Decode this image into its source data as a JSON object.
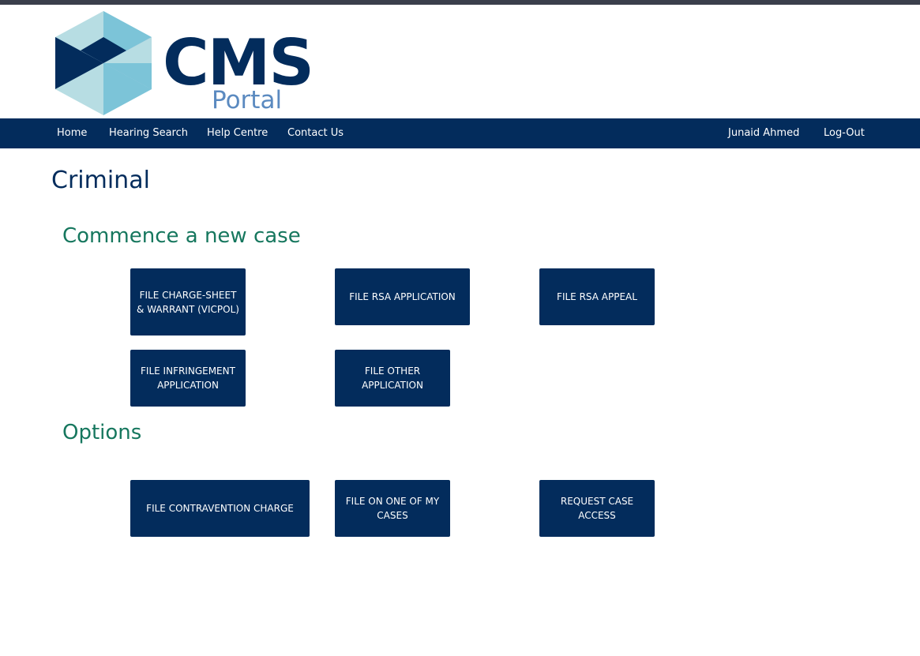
{
  "brand": {
    "title": "CMS",
    "subtitle": "Portal"
  },
  "nav": {
    "left": [
      "Home",
      "Hearing Search",
      "Help Centre",
      "Contact Us"
    ],
    "user": "Junaid Ahmed",
    "logout": "Log-Out"
  },
  "page": {
    "title": "Criminal"
  },
  "sections": {
    "commence": {
      "title": "Commence a new case",
      "buttons": [
        "FILE CHARGE-SHEET & WARRANT (VICPOL)",
        "FILE RSA APPLICATION",
        "FILE RSA APPEAL",
        "FILE INFRINGEMENT APPLICATION",
        "FILE OTHER APPLICATION"
      ]
    },
    "options": {
      "title": "Options",
      "buttons": [
        "FILE CONTRAVENTION CHARGE",
        "FILE ON ONE OF MY CASES",
        "REQUEST CASE ACCESS"
      ]
    }
  },
  "colors": {
    "navy": "#032c5c",
    "section_green": "#16775e",
    "portal_blue": "#5b8ac0",
    "top_strip": "#3a3f4b"
  },
  "icons": {
    "logo": "cms-hexagon-logo-icon"
  }
}
